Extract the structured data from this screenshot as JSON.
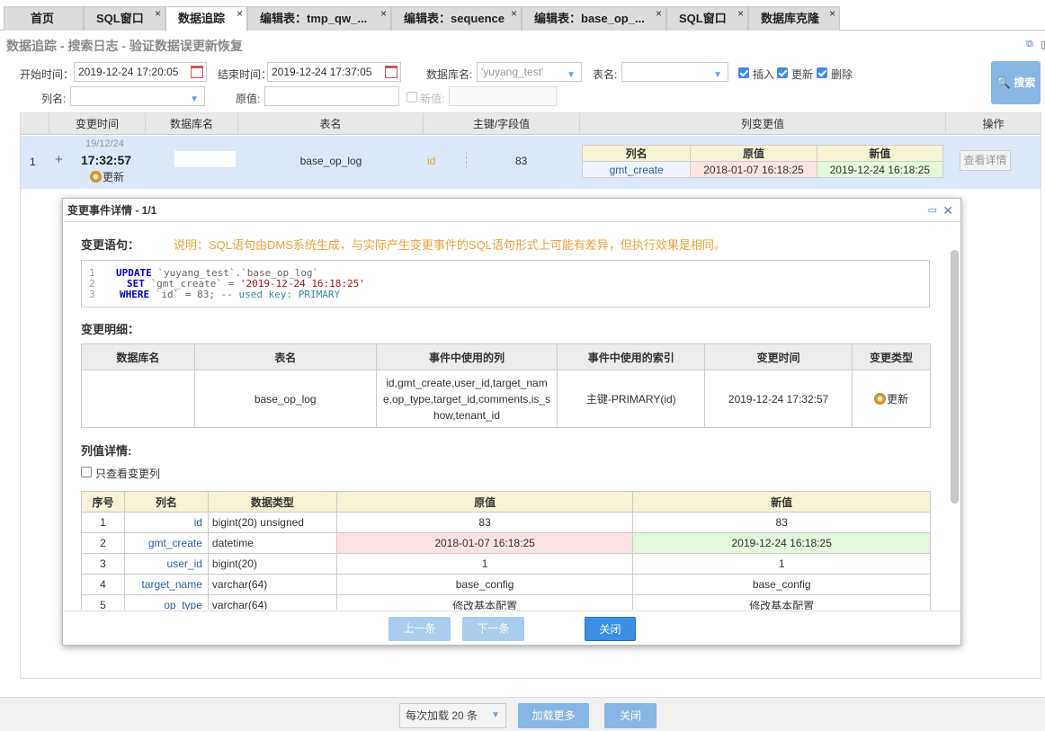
{
  "tabs": [
    {
      "label": "首页"
    },
    {
      "label": "SQL窗口"
    },
    {
      "label": "数据追踪"
    },
    {
      "label": "编辑表：tmp_qw_..."
    },
    {
      "label": "编辑表：sequence"
    },
    {
      "label": "编辑表：base_op_..."
    },
    {
      "label": "SQL窗口"
    },
    {
      "label": "数据库克隆"
    }
  ],
  "tab_close": "×",
  "page_title": "数据追踪 - 搜索日志 - 验证数据误更新恢复",
  "filters": {
    "start_label": "开始时间：",
    "start_value": "2019-12-24 17:20:05",
    "end_label": "结束时间：",
    "end_value": "2019-12-24 17:37:05",
    "db_label": "数据库名:",
    "db_value": "'yuyang_test'",
    "table_label": "表名:",
    "table_value": "",
    "insert_label": "插入",
    "update_label": "更新",
    "delete_label": "删除",
    "col_label": "列名:",
    "col_value": "",
    "old_label": "原值:",
    "old_value": "",
    "new_label": "新值:",
    "new_value": "",
    "search_label": "搜索"
  },
  "grid": {
    "headers": [
      "变更时间",
      "数据库名",
      "表名",
      "主键/字段值",
      "列变更值",
      "操作"
    ],
    "row": {
      "index": "1",
      "expand": "+",
      "date": "19/12/24",
      "time": "17:32:57",
      "type": "更新",
      "table": "base_op_log",
      "key": "id",
      "key_value": "83",
      "mini_headers": [
        "列名",
        "原值",
        "新值"
      ],
      "mini_col": "gmt_create",
      "mini_old": "2018-01-07 16:18:25",
      "mini_new": "2019-12-24 16:18:25",
      "detail_btn": "查看详情"
    }
  },
  "modal": {
    "title": "变更事件详情 - 1/1",
    "stmt_label": "变更语句：",
    "note": "说明：SQL语句由DMS系统生成，与实际产生变更事件的SQL语句形式上可能有差异，但执行效果是相同。",
    "code": {
      "l1": "1",
      "l2": "2",
      "l3": "3",
      "update_kw": "UPDATE",
      "update_rest": " `yuyang_test`.`base_op_log`",
      "set_kw": "SET",
      "set_col": " `gmt_create` = ",
      "set_val": "'2019-12-24 16:18:25'",
      "where_kw": "WHERE",
      "where_rest": " `id` = 83; ",
      "comment": "-- used key: PRIMARY"
    },
    "detail_label": "变更明细：",
    "detail_headers": [
      "数据库名",
      "表名",
      "事件中使用的列",
      "事件中使用的索引",
      "变更时间",
      "变更类型"
    ],
    "detail_row": {
      "table": "base_op_log",
      "cols": "id,gmt_create,user_id,target_name,op_type,target_id,comments,is_show,tenant_id",
      "index": "主键-PRIMARY(id)",
      "time": "2019-12-24 17:32:57",
      "type": "更新"
    },
    "col_detail_label": "列值详情:",
    "only_changed": "只查看变更列",
    "col_headers": [
      "序号",
      "列名",
      "数据类型",
      "原值",
      "新值"
    ],
    "col_rows": [
      {
        "n": "1",
        "name": "id",
        "type": "bigint(20) unsigned",
        "old": "83",
        "new": "83"
      },
      {
        "n": "2",
        "name": "gmt_create",
        "type": "datetime",
        "old": "2018-01-07 16:18:25",
        "new": "2019-12-24 16:18:25"
      },
      {
        "n": "3",
        "name": "user_id",
        "type": "bigint(20)",
        "old": "1",
        "new": "1"
      },
      {
        "n": "4",
        "name": "target_name",
        "type": "varchar(64)",
        "old": "base_config",
        "new": "base_config"
      },
      {
        "n": "5",
        "name": "op_type",
        "type": "varchar(64)",
        "old": "修改基本配置",
        "new": "修改基本配置"
      }
    ],
    "prev": "上一条",
    "next": "下一条",
    "close": "关闭"
  },
  "footer": {
    "per_load": "每次加载 20 条",
    "load_more": "加载更多",
    "close": "关闭"
  },
  "colors": {
    "accent": "#3a8ee6",
    "old_bg": "#fbe3e3",
    "new_bg": "#e3f8da",
    "note": "#e8a33c"
  }
}
